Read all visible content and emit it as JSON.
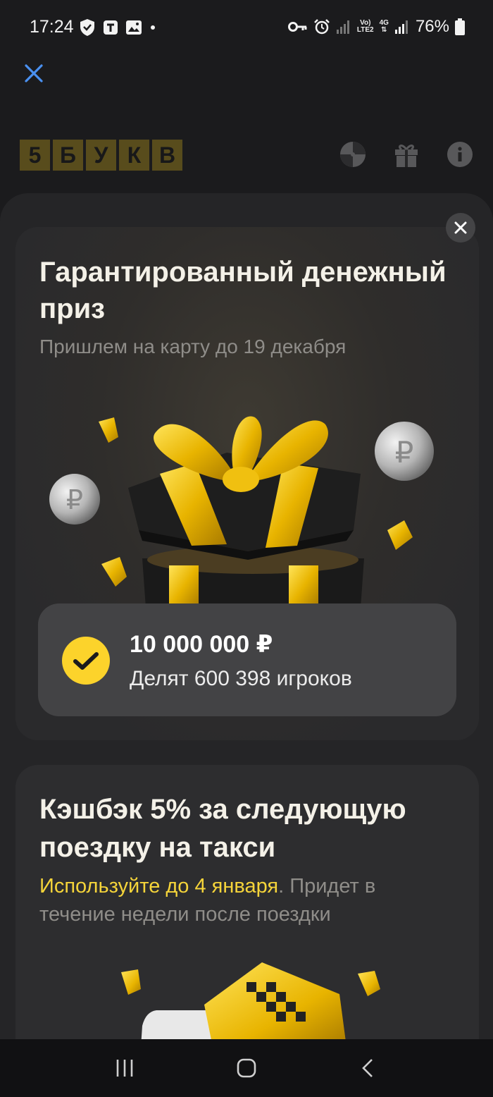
{
  "status_bar": {
    "time": "17:24",
    "battery": "76%",
    "network_top": "Vo)",
    "network_bottom": "LTE2",
    "gen": "4G",
    "icons": [
      "shield-icon",
      "t-app-icon",
      "image-icon",
      "dot-icon",
      "key-icon",
      "alarm-icon",
      "signal-icon",
      "battery-icon"
    ]
  },
  "header": {
    "logo_letters": [
      "5",
      "Б",
      "У",
      "К",
      "В"
    ],
    "icons": [
      "wheel-icon",
      "gift-icon",
      "info-icon"
    ]
  },
  "prize_card": {
    "title": "Гарантированный денежный приз",
    "subtitle": "Пришлем на карту до 19 декабря",
    "amount": "10 000 000 ₽",
    "players": "Делят 600 398 игроков"
  },
  "cashback_card": {
    "title": "Кэшбэк 5% за следующую поездку на такси",
    "subtitle_highlight": "Используйте до 4 января",
    "subtitle_rest": ". Придет в течение недели после поездки"
  },
  "colors": {
    "accent_yellow": "#fcd32b",
    "close_blue": "#4a90f0",
    "background": "#1b1b1d"
  }
}
